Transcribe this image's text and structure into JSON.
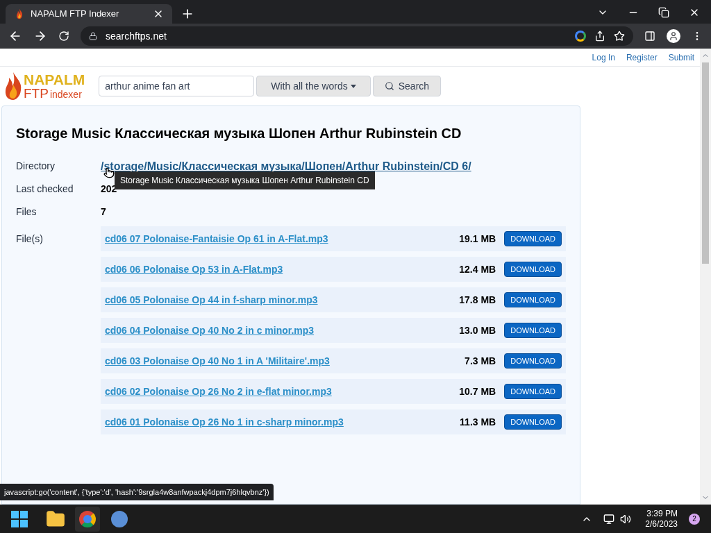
{
  "browser": {
    "tab_title": "NAPALM FTP Indexer",
    "url": "searchftps.net"
  },
  "top_links": [
    "Log In",
    "Register",
    "Submit"
  ],
  "logo": {
    "line1": "NAPALM",
    "line2a": "FTP",
    "line2b": "indexer"
  },
  "search": {
    "value": "arthur anime fan art",
    "mode": "With all the words",
    "button": "Search"
  },
  "title": "Storage Music Классическая музыка Шопен Arthur Rubinstein CD",
  "details": [
    {
      "label": "Directory",
      "value": "/storage/Music/Классическая музыка/Шопен/Arthur Rubinstein/CD 6/",
      "kind": "link"
    },
    {
      "label": "Last checked",
      "value": "202",
      "kind": "bold"
    },
    {
      "label": "Files",
      "value": "7",
      "kind": "bold"
    }
  ],
  "files_label": "File(s)",
  "files": [
    {
      "name": "cd06 07 Polonaise-Fantaisie Op 61 in A-Flat.mp3",
      "size": "19.1 MB",
      "button": "DOWNLOAD"
    },
    {
      "name": "cd06 06 Polonaise Op 53 in A-Flat.mp3",
      "size": "12.4 MB",
      "button": "DOWNLOAD"
    },
    {
      "name": "cd06 05 Polonaise Op 44 in f-sharp minor.mp3",
      "size": "17.8 MB",
      "button": "DOWNLOAD"
    },
    {
      "name": "cd06 04 Polonaise Op 40 No 2 in c minor.mp3",
      "size": "13.0 MB",
      "button": "DOWNLOAD"
    },
    {
      "name": "cd06 03 Polonaise Op 40 No 1 in A 'Militaire'.mp3",
      "size": "7.3 MB",
      "button": "DOWNLOAD"
    },
    {
      "name": "cd06 02 Polonaise Op 26 No 2 in e-flat minor.mp3",
      "size": "10.7 MB",
      "button": "DOWNLOAD"
    },
    {
      "name": "cd06 01 Polonaise Op 26 No 1 in c-sharp minor.mp3",
      "size": "11.3 MB",
      "button": "DOWNLOAD"
    }
  ],
  "tooltip": "Storage Music Классическая музыка Шопен Arthur Rubinstein CD",
  "status_url": "javascript:go('content', {'type':'d', 'hash':'9srgla4w8anfwpackj4dpm7j6hlqvbnz'})",
  "taskbar": {
    "time": "3:39 PM",
    "date": "2/6/2023",
    "badge": "2"
  }
}
